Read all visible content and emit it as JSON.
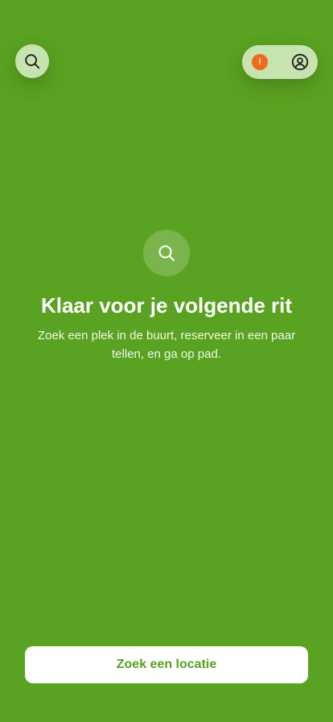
{
  "header": {
    "search_icon": "search-icon",
    "alert_icon": "alert-icon",
    "alert_symbol": "!",
    "profile_icon": "user-circle-icon"
  },
  "empty_state": {
    "icon": "search-icon",
    "title": "Klaar voor je volgende rit",
    "subtitle": "Zoek een plek in de buurt, reserveer in een paar tellen, en ga op pad."
  },
  "cta": {
    "label": "Zoek een locatie"
  },
  "colors": {
    "background": "#5aa221",
    "pill": "#c7e3b0",
    "alert": "#ef6a1a",
    "button_text": "#58a022",
    "button_bg": "#ffffff"
  }
}
